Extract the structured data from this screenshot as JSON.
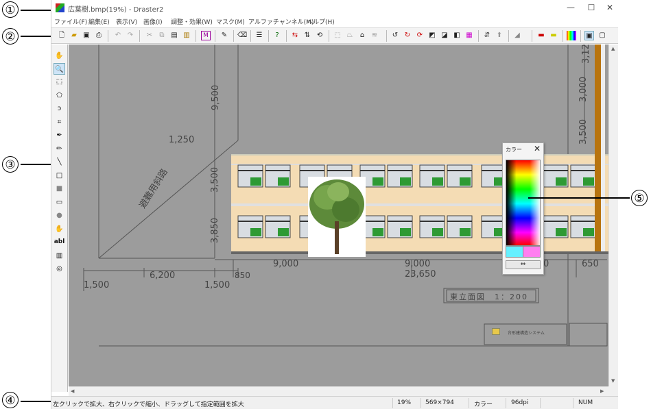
{
  "window": {
    "title": "広葉樹.bmp(19%) - Draster2",
    "min_label": "—",
    "max_label": "☐",
    "close_label": "✕"
  },
  "menu": [
    "ファイル(F)",
    "編集(E)",
    "表示(V)",
    "画像(I)",
    "調整・効果(W)",
    "マスク(M)",
    "アルファチャンネル(M)",
    "ヘルプ(H)"
  ],
  "callouts": [
    "①",
    "②",
    "③",
    "④",
    "⑤"
  ],
  "toolbar_icons": [
    "new-icon",
    "open-icon",
    "save-icon",
    "print-icon",
    "undo-icon",
    "redo-icon",
    "cut-icon",
    "copy-icon",
    "paste-icon",
    "paste-new-icon",
    "mask-icon",
    "scan-icon",
    "eraser-icon",
    "line-width-icon",
    "help-icon",
    "flip-horizontal-icon",
    "flip-vertical-icon",
    "rotate-icon",
    "transform-icon",
    "perspective-icon",
    "warp-icon",
    "rotate-left-icon",
    "rotate-180-icon",
    "rotate-90-icon",
    "invert-icon",
    "grayscale-icon",
    "threshold-icon",
    "color-adjust-icon",
    "resize-icon",
    "levels-icon",
    "gradient-icon",
    "display-red-icon",
    "display-yellow-icon",
    "color-bar-icon",
    "view-full-icon",
    "view-fit-icon"
  ],
  "left_tools": [
    "hand-icon",
    "zoom-icon",
    "rect-select-icon",
    "polygon-select-icon",
    "lasso-icon",
    "crop-icon",
    "eyedropper-icon",
    "pencil-icon",
    "line-icon",
    "rectangle-icon",
    "filled-rectangle-icon",
    "ellipse-icon",
    "filled-ellipse-icon",
    "fill-icon",
    "text-icon",
    "gradient-fill-icon",
    "stamp-icon"
  ],
  "left_tool_text": {
    "text_tool_label": "abl"
  },
  "drawing": {
    "dims": {
      "d9500": "9,500",
      "d1250": "1,250",
      "d3500": "3,500",
      "d3850": "3,850",
      "d3000": "3,000",
      "d3500r": "3,500",
      "d312": "3,12",
      "slope_label": "避難用斜路",
      "b9000a": "9,000",
      "b9000b": "9,000",
      "b650": "650",
      "b23650": "23,650",
      "b850": "850",
      "b6200": "6,200",
      "b1500a": "1,500",
      "b1500b": "1,500",
      "b0": "0",
      "elevation_title": "東立面図　1：200",
      "logo_company": "台形建構造システム"
    }
  },
  "palette": {
    "title": "カラー",
    "close": "✕",
    "swap": "⇔",
    "swatch_a": "#66f0ff",
    "swatch_b": "#ff7ef0"
  },
  "status": {
    "hint": "左クリックで拡大、右クリックで縮小、ドラッグして指定範囲を拡大",
    "zoom": "19%",
    "size": "569×794",
    "mode": "カラー",
    "dpi": "96dpi",
    "num": "NUM"
  }
}
